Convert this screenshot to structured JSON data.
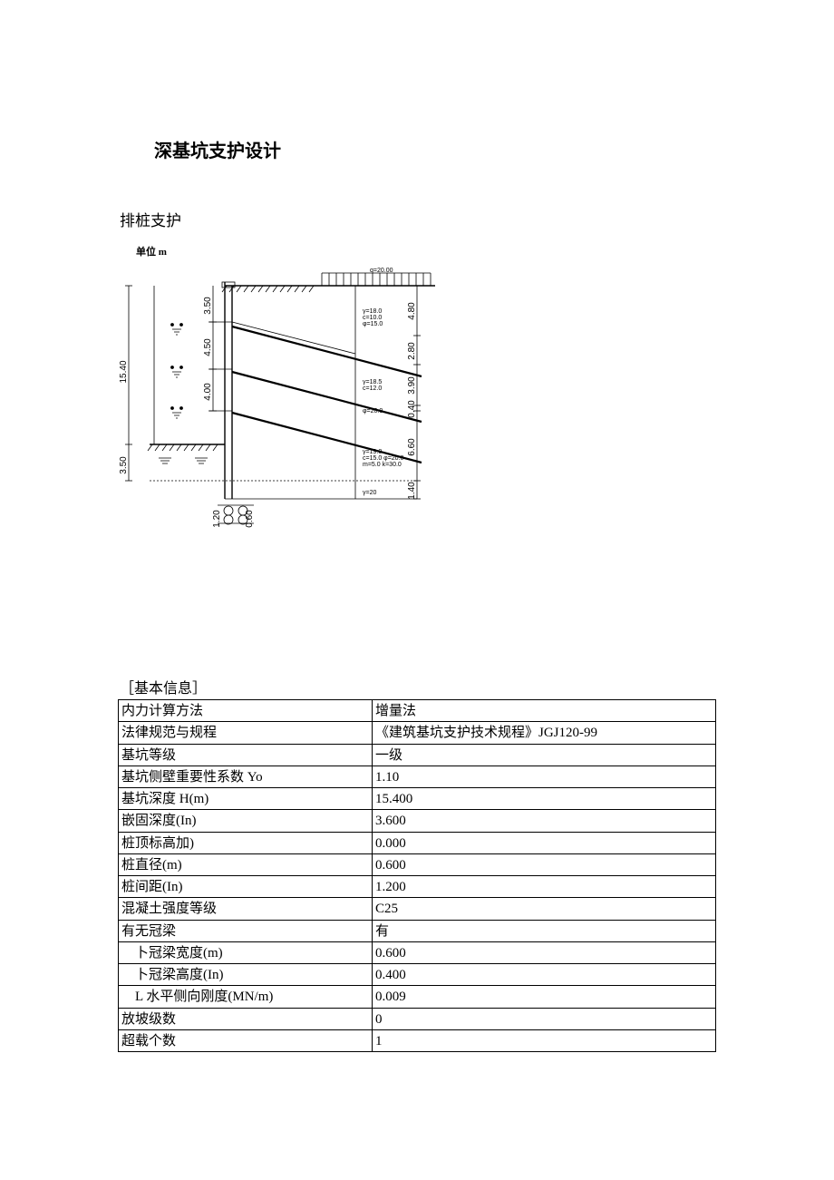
{
  "title": "深基坑支护设计",
  "subtitle": "排桩支护",
  "unit_label": "单位 m",
  "section_header": "［基本信息］",
  "diagram": {
    "d_15_40": "15.40",
    "d_3_50_left": "3.50",
    "d_3_50": "3.50",
    "d_4_50": "4.50",
    "d_4_00": "4.00",
    "d_1_20": "1.20",
    "d_0_60": "0.60",
    "d_4_80": "4.80",
    "d_2_80": "2.80",
    "d_3_90": "3.90",
    "d_0_40": "0.40",
    "d_6_60": "6.60",
    "d_1_40": "1.40",
    "surcharge": "q=20.00"
  },
  "rows": [
    {
      "label": "内力计算方法",
      "value": "增量法",
      "indent": 0
    },
    {
      "label": "法律规范与规程",
      "value": "《建筑基坑支护技术规程》JGJ120-99",
      "indent": 0
    },
    {
      "label": "基坑等级",
      "value": "一级",
      "indent": 0
    },
    {
      "label": "基坑侧壁重要性系数 Yo",
      "value": "1.10",
      "indent": 0
    },
    {
      "label": "基坑深度 H(m)",
      "value": "15.400",
      "indent": 0
    },
    {
      "label": "嵌固深度(In)",
      "value": "3.600",
      "indent": 0
    },
    {
      "label": "桩顶标高加)",
      "value": "0.000",
      "indent": 0
    },
    {
      "label": "桩直径(m)",
      "value": "0.600",
      "indent": 0
    },
    {
      "label": "桩间距(In)",
      "value": "1.200",
      "indent": 0
    },
    {
      "label": "混凝土强度等级",
      "value": "C25",
      "indent": 0
    },
    {
      "label": "有无冠梁",
      "value": "有",
      "indent": 0
    },
    {
      "label": "卜冠梁宽度(m)",
      "value": "0.600",
      "indent": 1
    },
    {
      "label": "卜冠梁高度(In)",
      "value": "0.400",
      "indent": 1
    },
    {
      "label": "L 水平侧向刚度(MN/m)",
      "value": "0.009",
      "indent": 1
    },
    {
      "label": "放坡级数",
      "value": "0",
      "indent": 0
    },
    {
      "label": "超载个数",
      "value": "1",
      "indent": 0
    }
  ]
}
